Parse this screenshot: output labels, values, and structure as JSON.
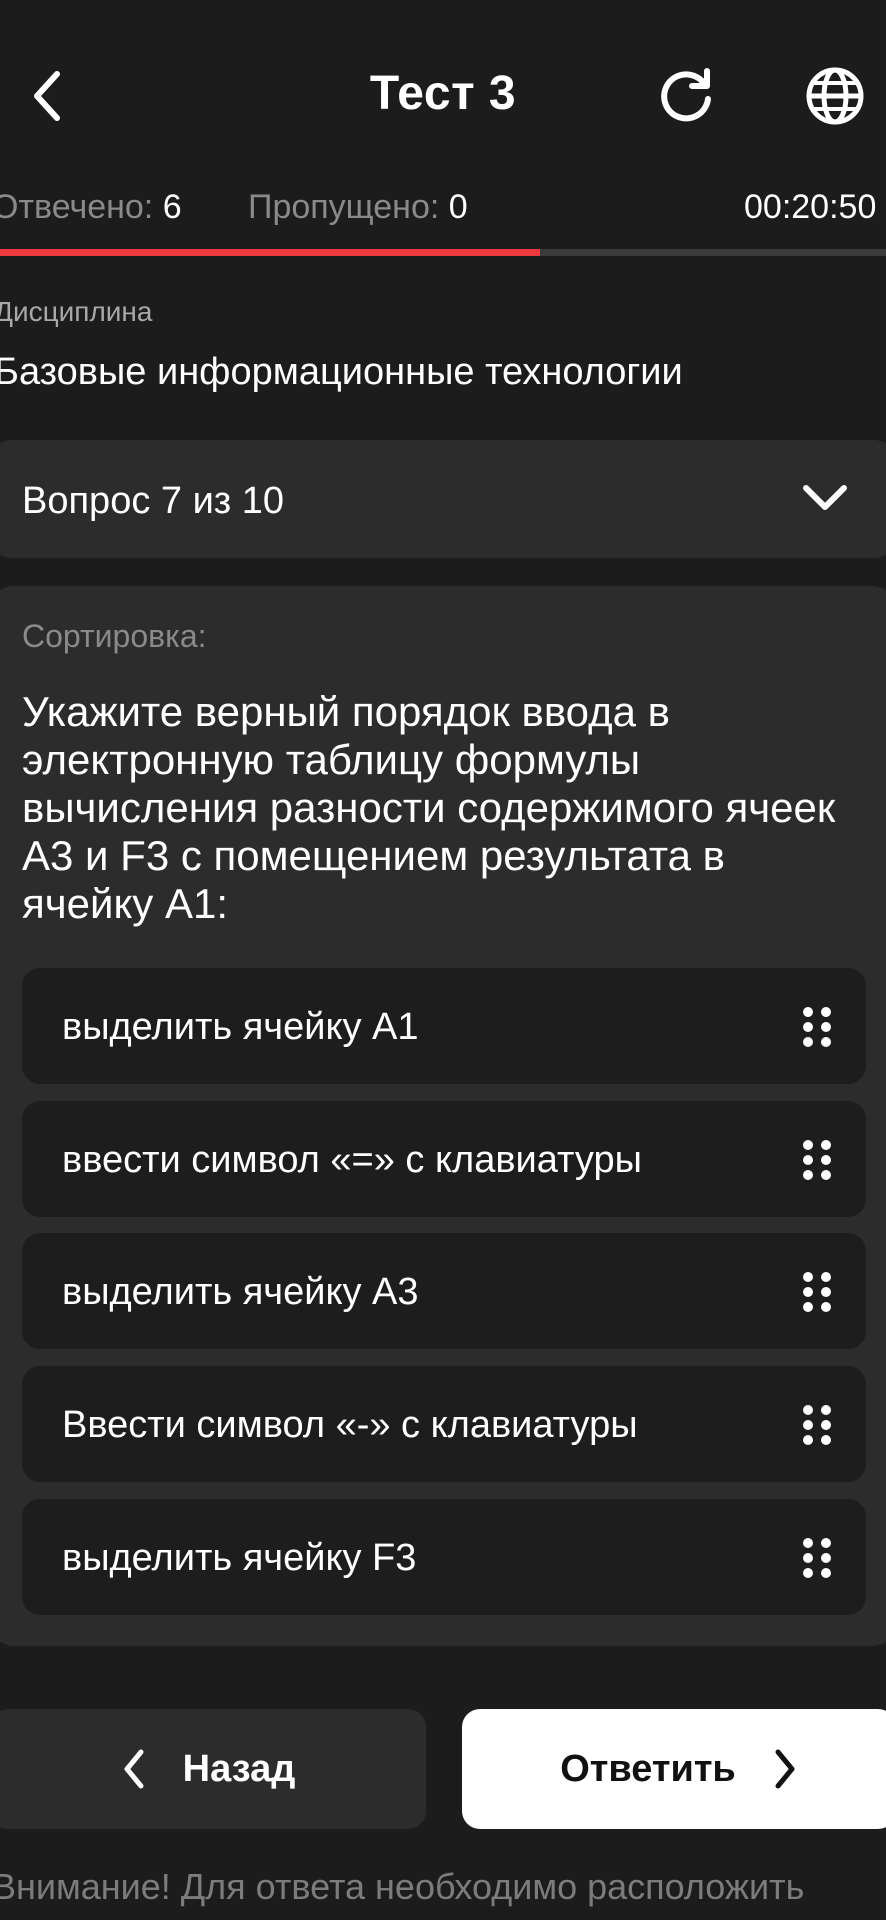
{
  "header": {
    "title": "Тест 3"
  },
  "stats": {
    "answered_label": "Отвечено:",
    "answered_value": "6",
    "skipped_label": "Пропущено:",
    "skipped_value": "0",
    "timer": "00:20:50"
  },
  "progress": {
    "fraction": 0.61
  },
  "discipline": {
    "label": "Дисциплина",
    "name": "Базовые информационные технологии"
  },
  "question_selector": {
    "label": "Вопрос 7 из 10"
  },
  "question": {
    "type": "Сортировка:",
    "text": "Укажите верный порядок ввода в электронную таблицу формулы вычисления разности содержимого ячеек A3 и F3 с помещением результата в ячейку A1:",
    "options": [
      {
        "text": "выделить ячейку A1"
      },
      {
        "text": "ввести символ «=» с клавиатуры"
      },
      {
        "text": "выделить ячейку A3"
      },
      {
        "text": "Ввести символ «-» с клавиатуры"
      },
      {
        "text": "выделить ячейку F3"
      }
    ]
  },
  "navigation": {
    "back_label": "Назад",
    "answer_label": "Ответить"
  },
  "notice": "Внимание! Для ответа необходимо расположить",
  "colors": {
    "background": "#1c1c1c",
    "card": "#2c2c2c",
    "option": "#1d1d1d",
    "accent": "#ee3a3f"
  },
  "icons": {
    "back": "chevron-left-icon",
    "refresh": "refresh-icon",
    "language": "globe-icon",
    "dropdown": "chevron-down-icon",
    "drag": "drag-handle-icon"
  }
}
